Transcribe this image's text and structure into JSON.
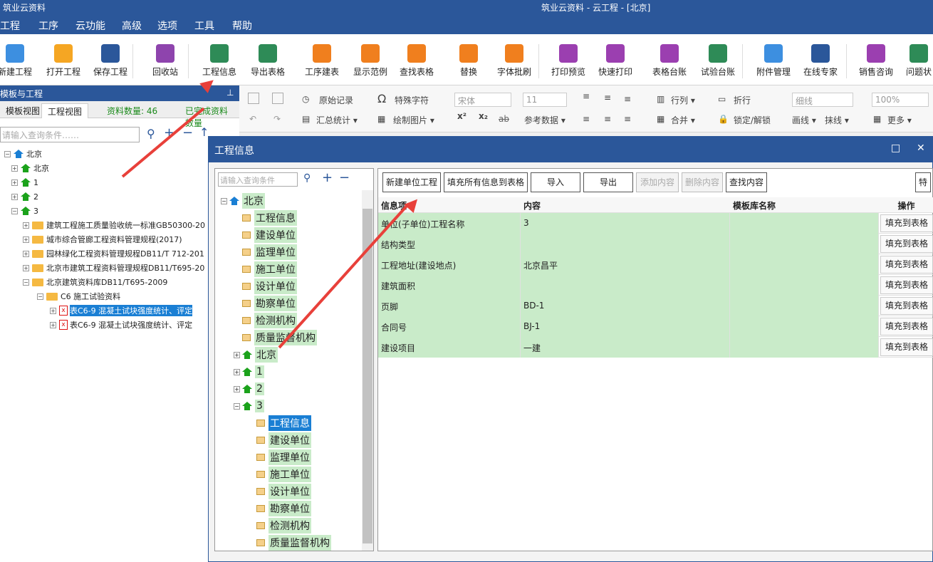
{
  "window": {
    "app_name": "筑业云资料",
    "title": "筑业云资料 - 云工程 - [北京]"
  },
  "menu": [
    "工程",
    "工序",
    "云功能",
    "高级",
    "选项",
    "工具",
    "帮助"
  ],
  "ribbon": [
    {
      "label": "新建工程",
      "icon": "new-doc-icon",
      "color": "#3d8fe0"
    },
    {
      "label": "打开工程",
      "icon": "folder-open-icon",
      "color": "#f5a623"
    },
    {
      "label": "保存工程",
      "icon": "save-icon",
      "color": "#2b579a"
    },
    {
      "label": "回收站",
      "icon": "trash-icon",
      "color": "#8e44ad"
    },
    {
      "label": "工程信息",
      "icon": "info-icon",
      "color": "#2e8b57"
    },
    {
      "label": "导出表格",
      "icon": "export-icon",
      "color": "#2e8b57"
    },
    {
      "label": "工序建表",
      "icon": "layers-icon",
      "color": "#f07f1e"
    },
    {
      "label": "显示范例",
      "icon": "example-icon",
      "color": "#f07f1e"
    },
    {
      "label": "查找表格",
      "icon": "search-icon",
      "color": "#f07f1e"
    },
    {
      "label": "替换",
      "icon": "replace-icon",
      "color": "#f07f1e"
    },
    {
      "label": "字体批刷",
      "icon": "font-brush-icon",
      "color": "#f07f1e"
    },
    {
      "label": "打印预览",
      "icon": "eye-icon",
      "color": "#9b3fb0"
    },
    {
      "label": "快速打印",
      "icon": "printer-icon",
      "color": "#9b3fb0"
    },
    {
      "label": "表格台账",
      "icon": "ledger-icon",
      "color": "#9b3fb0"
    },
    {
      "label": "试验台账",
      "icon": "test-ledger-icon",
      "color": "#2e8b57"
    },
    {
      "label": "附件管理",
      "icon": "paperclip-icon",
      "color": "#3d8fe0"
    },
    {
      "label": "在线专家",
      "icon": "expert-icon",
      "color": "#2b579a"
    },
    {
      "label": "销售咨询",
      "icon": "headset-icon",
      "color": "#9b3fb0"
    },
    {
      "label": "问题状",
      "icon": "question-icon",
      "color": "#2e8b57"
    }
  ],
  "toolbar2": {
    "original_record": "原始记录",
    "special_char": "特殊字符",
    "font": "宋体",
    "size": "11",
    "summary": "汇总统计 ▾",
    "draw_image": "绘制图片 ▾",
    "ref_data": "参考数据 ▾",
    "rowcol": "行列 ▾",
    "merge": "合并 ▾",
    "wrap": "折行",
    "lock": "锁定/解锁",
    "line_style": "细线",
    "draw_line": "画线 ▾",
    "erase_line": "抹线 ▾",
    "zoom": "100%",
    "more": "更多 ▾",
    "sup": "x²",
    "sub": "x₂",
    "strike": "ab"
  },
  "left_panel": {
    "header": "模板与工程",
    "tabs": [
      "模板视图",
      "工程视图"
    ],
    "count_label": "资料数量: 46",
    "done_label": "已完成资料数量",
    "search_placeholder": "请输入查询条件……",
    "tree": [
      {
        "label": "北京",
        "type": "house-blue",
        "level": 0
      },
      {
        "label": "北京",
        "type": "house",
        "level": 1
      },
      {
        "label": "1",
        "type": "house",
        "level": 1
      },
      {
        "label": "2",
        "type": "house",
        "level": 1
      },
      {
        "label": "3",
        "type": "house",
        "level": 1
      },
      {
        "label": "建筑工程施工质量验收统一标准GB50300-20",
        "type": "folder",
        "level": 2
      },
      {
        "label": "城市综合管廊工程资料管理规程(2017)",
        "type": "folder",
        "level": 2
      },
      {
        "label": "园林绿化工程资料管理规程DB11/T 712-201",
        "type": "folder",
        "level": 2
      },
      {
        "label": "北京市建筑工程资料管理规程DB11/T695-20",
        "type": "folder",
        "level": 2
      },
      {
        "label": "北京建筑资料库DB11/T695-2009",
        "type": "folder",
        "level": 2
      },
      {
        "label": "C6 施工试验资料",
        "type": "folder",
        "level": 3
      },
      {
        "label": "表C6-9 混凝土试块强度统计、评定",
        "type": "red",
        "level": 4,
        "selected": true
      },
      {
        "label": "表C6-9 混凝土试块强度统计、评定",
        "type": "red",
        "level": 4
      }
    ]
  },
  "dialog": {
    "title": "工程信息",
    "search_placeholder": "请输入查询条件",
    "tree": [
      {
        "label": "北京",
        "type": "root"
      },
      {
        "label": "工程信息",
        "type": "doc"
      },
      {
        "label": "建设单位",
        "type": "doc"
      },
      {
        "label": "监理单位",
        "type": "doc"
      },
      {
        "label": "施工单位",
        "type": "doc"
      },
      {
        "label": "设计单位",
        "type": "doc"
      },
      {
        "label": "勘察单位",
        "type": "doc"
      },
      {
        "label": "检测机构",
        "type": "doc"
      },
      {
        "label": "质量监督机构",
        "type": "doc"
      },
      {
        "label": "北京",
        "type": "house"
      },
      {
        "label": "1",
        "type": "house"
      },
      {
        "label": "2",
        "type": "house"
      },
      {
        "label": "3",
        "type": "house"
      },
      {
        "label": "工程信息",
        "type": "doc2",
        "selected": true
      },
      {
        "label": "建设单位",
        "type": "doc2"
      },
      {
        "label": "监理单位",
        "type": "doc2"
      },
      {
        "label": "施工单位",
        "type": "doc2"
      },
      {
        "label": "设计单位",
        "type": "doc2"
      },
      {
        "label": "勘察单位",
        "type": "doc2"
      },
      {
        "label": "检测机构",
        "type": "doc2"
      },
      {
        "label": "质量监督机构",
        "type": "doc2"
      }
    ],
    "buttons": [
      {
        "label": "新建单位工程",
        "enabled": true
      },
      {
        "label": "填充所有信息到表格",
        "enabled": true
      },
      {
        "label": "导入",
        "enabled": true
      },
      {
        "label": "导出",
        "enabled": true
      },
      {
        "label": "添加内容",
        "enabled": false
      },
      {
        "label": "删除内容",
        "enabled": false
      },
      {
        "label": "查找内容",
        "enabled": true
      },
      {
        "label": "特",
        "enabled": true
      }
    ],
    "columns": [
      "信息项",
      "内容",
      "模板库名称",
      "操作"
    ],
    "rows": [
      {
        "item": "单位(子单位)工程名称",
        "content": "3",
        "template": "",
        "action": "填充到表格"
      },
      {
        "item": "结构类型",
        "content": "",
        "template": "",
        "action": "填充到表格"
      },
      {
        "item": "工程地址(建设地点)",
        "content": "北京昌平",
        "template": "",
        "action": "填充到表格"
      },
      {
        "item": "建筑面积",
        "content": "",
        "template": "",
        "action": "填充到表格"
      },
      {
        "item": "页脚",
        "content": "BD-1",
        "template": "",
        "action": "填充到表格"
      },
      {
        "item": "合同号",
        "content": "BJ-1",
        "template": "",
        "action": "填充到表格"
      },
      {
        "item": "建设项目",
        "content": "一建",
        "template": "",
        "action": "填充到表格"
      }
    ],
    "controls": {
      "maximize": "□",
      "close": "✕"
    }
  },
  "colors": {
    "accent": "#2b579a",
    "row_green": "#c9ebc9",
    "selection": "#1a7fd4",
    "annotation": "#e8403a"
  }
}
